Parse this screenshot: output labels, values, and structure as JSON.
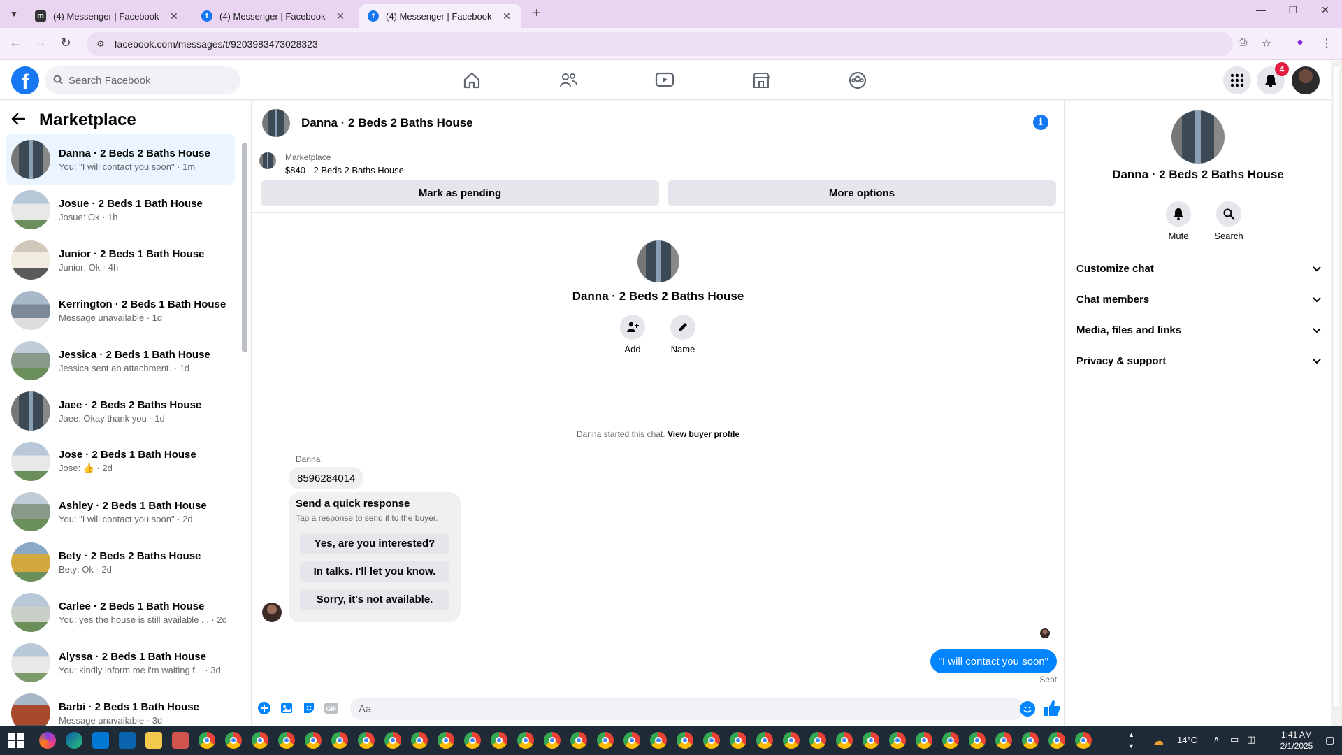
{
  "browser": {
    "tabs": [
      {
        "title": "(4) Messenger | Facebook",
        "icon": "messenger-dark-icon"
      },
      {
        "title": "(4) Messenger | Facebook",
        "icon": "facebook-icon"
      },
      {
        "title": "(4) Messenger | Facebook",
        "icon": "facebook-icon"
      }
    ],
    "url": "facebook.com/messages/t/9203983473028323"
  },
  "header": {
    "search_placeholder": "Search Facebook",
    "notification_count": "4"
  },
  "sidebar": {
    "title": "Marketplace",
    "conversations": [
      {
        "name": "Danna · 2 Beds 2 Baths House",
        "sub": "You: \"I will contact you soon\" · 1m"
      },
      {
        "name": "Josue · 2 Beds 1 Bath House",
        "sub": "Josue: Ok · 1h"
      },
      {
        "name": "Junior · 2 Beds 1 Bath House",
        "sub": "Junior: Ok · 4h"
      },
      {
        "name": "Kerrington · 2 Beds 1 Bath House",
        "sub": "Message unavailable · 1d"
      },
      {
        "name": "Jessica · 2 Beds 1 Bath House",
        "sub": "Jessica sent an attachment. · 1d"
      },
      {
        "name": "Jaee · 2 Beds 2 Baths House",
        "sub": "Jaee: Okay thank you · 1d"
      },
      {
        "name": "Jose · 2 Beds 1 Bath House",
        "sub": "Jose: 👍 · 2d"
      },
      {
        "name": "Ashley · 2 Beds 1 Bath House",
        "sub": "You: \"I will contact you soon\" · 2d"
      },
      {
        "name": "Bety · 2 Beds 2 Baths House",
        "sub": "Bety: Ok · 2d"
      },
      {
        "name": "Carlee · 2 Beds 1 Bath House",
        "sub": "You: yes the house is still available ... · 2d"
      },
      {
        "name": "Alyssa · 2 Beds 1 Bath House",
        "sub": "You: kindly inform me i'm waiting f... · 3d"
      },
      {
        "name": "Barbi · 2 Beds 1 Bath House",
        "sub": "Message unavailable · 3d"
      }
    ]
  },
  "chat": {
    "title": "Danna · 2 Beds 2 Baths House",
    "marketplace_label": "Marketplace",
    "listing": "$840 - 2 Beds 2 Baths House",
    "mark_pending": "Mark as pending",
    "more_options": "More options",
    "intro_name": "Danna · 2 Beds 2 Baths House",
    "add_label": "Add",
    "name_label": "Name",
    "started_text": "Danna started this chat.",
    "buyer_profile": "View buyer profile",
    "sender": "Danna",
    "incoming_message": "8596284014",
    "quick_title": "Send a quick response",
    "quick_sub": "Tap a response to send it to the buyer.",
    "quick_responses": [
      "Yes, are you interested?",
      "In talks. I'll let you know.",
      "Sorry, it's not available."
    ],
    "outgoing_message": "\"I will contact you soon\"",
    "sent_label": "Sent",
    "composer_placeholder": "Aa"
  },
  "details": {
    "name": "Danna · 2 Beds 2 Baths House",
    "mute_label": "Mute",
    "search_label": "Search",
    "sections": [
      "Customize chat",
      "Chat members",
      "Media, files and links",
      "Privacy & support"
    ]
  },
  "taskbar": {
    "temperature": "14°C",
    "time": "1:41 AM",
    "date": "2/1/2025"
  },
  "colors": {
    "brand": "#1877f2",
    "messenger_blue": "#0084ff",
    "active_row": "#ebf5ff",
    "tab_strip": "#e9d5f2"
  }
}
